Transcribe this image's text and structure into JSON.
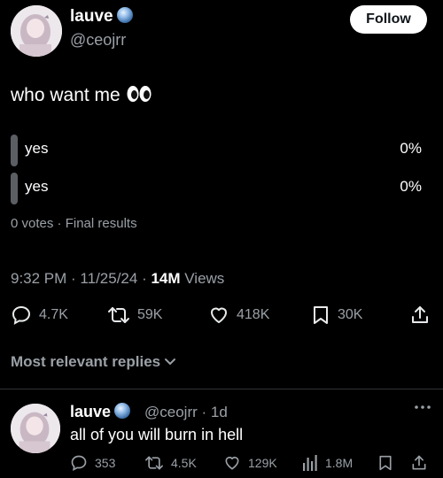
{
  "post": {
    "author_name": "lauve",
    "handle": "@ceojrr",
    "follow_label": "Follow",
    "text": "who want me",
    "poll": {
      "options": [
        {
          "label": "yes",
          "percent": "0%"
        },
        {
          "label": "yes",
          "percent": "0%"
        }
      ],
      "votes": "0 votes",
      "status": "Final results"
    },
    "time": "9:32 PM",
    "date": "11/25/24",
    "views_count": "14M",
    "views_label": "Views",
    "actions": {
      "replies": "4.7K",
      "reposts": "59K",
      "likes": "418K",
      "bookmarks": "30K"
    }
  },
  "replies_sort_label": "Most relevant replies",
  "reply": {
    "author_name": "lauve",
    "handle": "@ceojrr",
    "age": "1d",
    "text": "all of you will burn in hell",
    "actions": {
      "replies": "353",
      "reposts": "4.5K",
      "likes": "129K",
      "views": "1.8M"
    }
  },
  "icons": {
    "verified_badge": "blue-orb-badge-icon",
    "reply": "speech-bubble-icon",
    "repost": "repost-arrows-icon",
    "like": "heart-icon",
    "bookmark": "bookmark-icon",
    "share": "share-upload-icon",
    "views": "bar-chart-icon",
    "more": "more-dots-icon"
  },
  "colors": {
    "background": "#000000",
    "text_primary": "#e7e9ea",
    "text_secondary": "#9aa0a6",
    "poll_bar": "#5b5f64",
    "follow_bg": "#ffffff"
  }
}
